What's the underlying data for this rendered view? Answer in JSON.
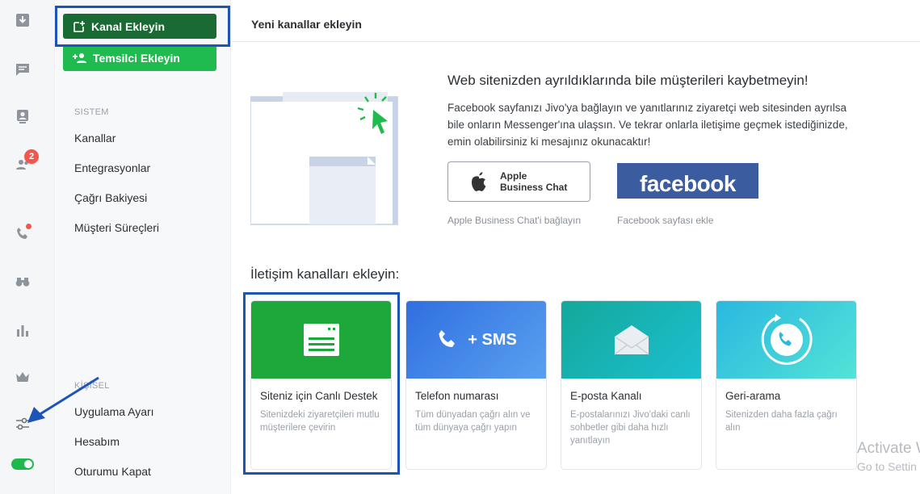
{
  "rail": {
    "badge_count": "2",
    "icons": [
      "download-icon",
      "chat-icon",
      "contacts-icon",
      "team-icon",
      "phone-icon",
      "binoculars-icon",
      "stats-icon",
      "crown-icon",
      "settings-sliders-icon",
      "status-toggle"
    ]
  },
  "sidebar": {
    "add_channel": "Kanal Ekleyin",
    "add_agent": "Temsilci Ekleyin",
    "system_label": "SISTEM",
    "system_items": [
      "Kanallar",
      "Entegrasyonlar",
      "Çağrı Bakiyesi",
      "Müşteri Süreçleri"
    ],
    "personal_label": "KİŞİSEL",
    "personal_items": [
      "Uygulama Ayarı",
      "Hesabım",
      "Oturumu Kapat"
    ]
  },
  "header": {
    "title": "Yeni kanallar ekleyin"
  },
  "promo": {
    "title": "Web sitenizden ayrıldıklarında bile müşterileri kaybetmeyin!",
    "text": "Facebook sayfanızı Jivo'ya bağlayın ve yanıtlarınız ziyaretçi web sitesinden ayrılsa bile onların Messenger'ına ulaşsın. Ve tekrar onlarla iletişime geçmek istediğinizde, emin olabilirsiniz ki mesajınız okunacaktır!",
    "apple_line1": "Apple",
    "apple_line2": "Business Chat",
    "apple_caption": "Apple Business Chat'i bağlayın",
    "facebook_label": "facebook",
    "facebook_caption": "Facebook sayfası ekle"
  },
  "channels": {
    "heading": "İletişim kanalları ekleyin:",
    "cards": [
      {
        "title": "Siteniz için Canlı Destek",
        "desc": "Sitenizdeki ziyaretçileri mutlu müşterilere çevirin",
        "icon": "chat-window-icon"
      },
      {
        "title": "Telefon numarası",
        "desc": "Tüm dünyadan çağrı alın ve tüm dünyaya çağrı yapın",
        "icon": "phone-icon",
        "badge": "+ SMS"
      },
      {
        "title": "E-posta Kanalı",
        "desc": "E-postalarınızı Jivo'daki canlı sohbetler gibi daha hızlı yanıtlayın",
        "icon": "envelope-icon"
      },
      {
        "title": "Geri-arama",
        "desc": "Sitenizden daha fazla çağrı alın",
        "icon": "callback-icon"
      }
    ]
  },
  "watermark": {
    "line1": "Activate W",
    "line2": "Go to Settin"
  },
  "colors": {
    "brand_green": "#1fbb4f",
    "dark_green": "#1a6a33",
    "highlight_blue": "#1c54b8",
    "badge_red": "#f2574d"
  }
}
